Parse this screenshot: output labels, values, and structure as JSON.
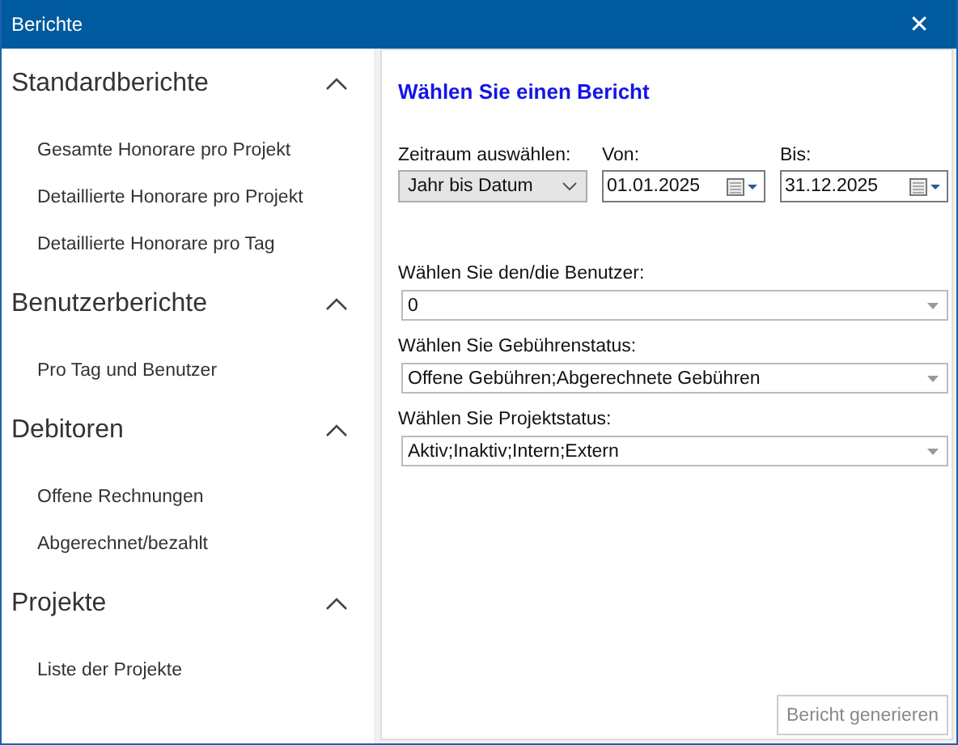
{
  "window": {
    "title": "Berichte",
    "close": "✕"
  },
  "sidebar": {
    "sections": [
      {
        "title": "Standardberichte",
        "expanded": true,
        "items": [
          "Gesamte Honorare pro Projekt",
          "Detaillierte Honorare pro Projekt",
          "Detaillierte Honorare pro Tag"
        ]
      },
      {
        "title": "Benutzerberichte",
        "expanded": true,
        "items": [
          "Pro Tag und Benutzer"
        ]
      },
      {
        "title": "Debitoren",
        "expanded": true,
        "items": [
          "Offene Rechnungen",
          "Abgerechnet/bezahlt"
        ]
      },
      {
        "title": "Projekte",
        "expanded": true,
        "items": [
          "Liste der Projekte"
        ]
      }
    ]
  },
  "panel": {
    "title": "Wählen Sie einen Bericht",
    "period": {
      "label": "Zeitraum auswählen:",
      "value": "Jahr bis Datum"
    },
    "from": {
      "label": "Von:",
      "value": "01.01.2025"
    },
    "to": {
      "label": "Bis:",
      "value": "31.12.2025"
    },
    "selects": [
      {
        "label": "Wählen Sie den/die Benutzer:",
        "value": "0"
      },
      {
        "label": "Wählen Sie Gebührenstatus:",
        "value": "Offene Gebühren;Abgerechnete Gebühren"
      },
      {
        "label": "Wählen Sie Projektstatus:",
        "value": "Aktiv;Inaktiv;Intern;Extern"
      }
    ],
    "button": {
      "label": "Bericht generieren",
      "disabled": true
    }
  }
}
